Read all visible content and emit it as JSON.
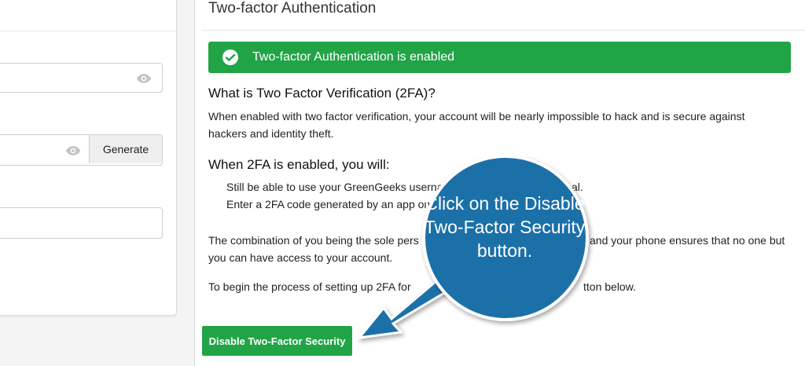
{
  "left": {
    "generate_label": "Generate"
  },
  "right": {
    "title": "Two-factor Authentication",
    "alert_text": "Two-factor Authentication is enabled",
    "what_heading": "What is Two Factor Verification (2FA)?",
    "what_text_1": "When enabled with two factor verification, your account will be nearly impossible to hack and is secure against",
    "what_text_2": "hackers and identity theft.",
    "when_heading": "When 2FA is enabled, you will:",
    "bullet_1": "Still be able to use your GreenGeeks usernam",
    "bullet_1_end": "al.",
    "bullet_2": "Enter a 2FA code generated by an app on",
    "combo_1_a": "The combination of you being the sole pers",
    "combo_1_b": "and your phone ensures that no one but",
    "combo_2": "you can have access to your account.",
    "begin_a": "To begin the process of setting up 2FA for",
    "begin_b": "tton below.",
    "disable_button": "Disable Two-Factor Security"
  },
  "callout": {
    "text": "Click on the Disable Two-Factor Security button."
  },
  "colors": {
    "green": "#21a446",
    "callout_blue": "#1f6fa8"
  },
  "icons": {
    "password_visibility": "eye-icon",
    "alert": "check-circle-icon",
    "annotation_arrow": "arrow-icon"
  }
}
